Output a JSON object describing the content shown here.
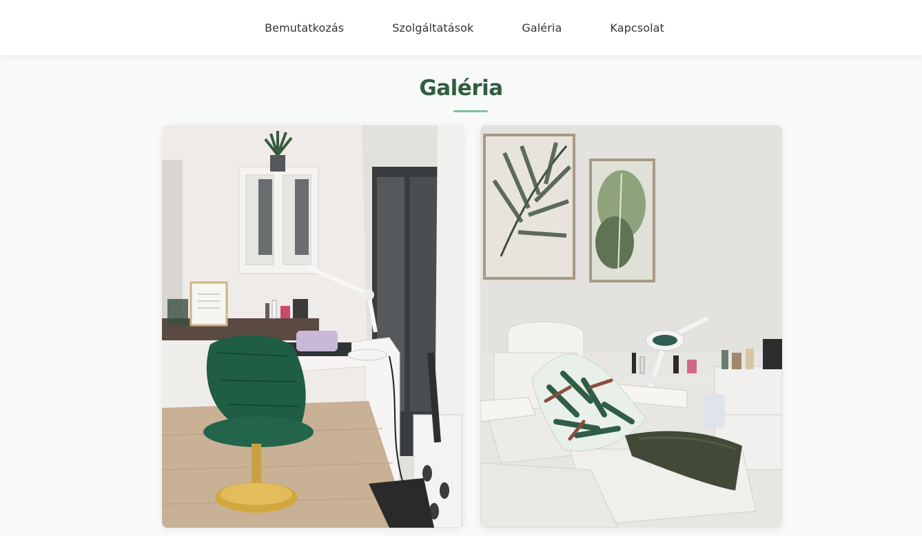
{
  "nav": {
    "items": [
      {
        "label": "Bemutatkozás"
      },
      {
        "label": "Szolgáltatások"
      },
      {
        "label": "Galéria"
      },
      {
        "label": "Kapcsolat"
      }
    ]
  },
  "gallery": {
    "title": "Galéria",
    "photos": [
      {
        "subject": "manicure-station-photo"
      },
      {
        "subject": "treatment-chair-photo"
      }
    ]
  },
  "colors": {
    "title": "#2e5e3e",
    "accent": "#7cc39a",
    "chair_green": "#1f5e45",
    "page_bg": "#f8fafa"
  }
}
